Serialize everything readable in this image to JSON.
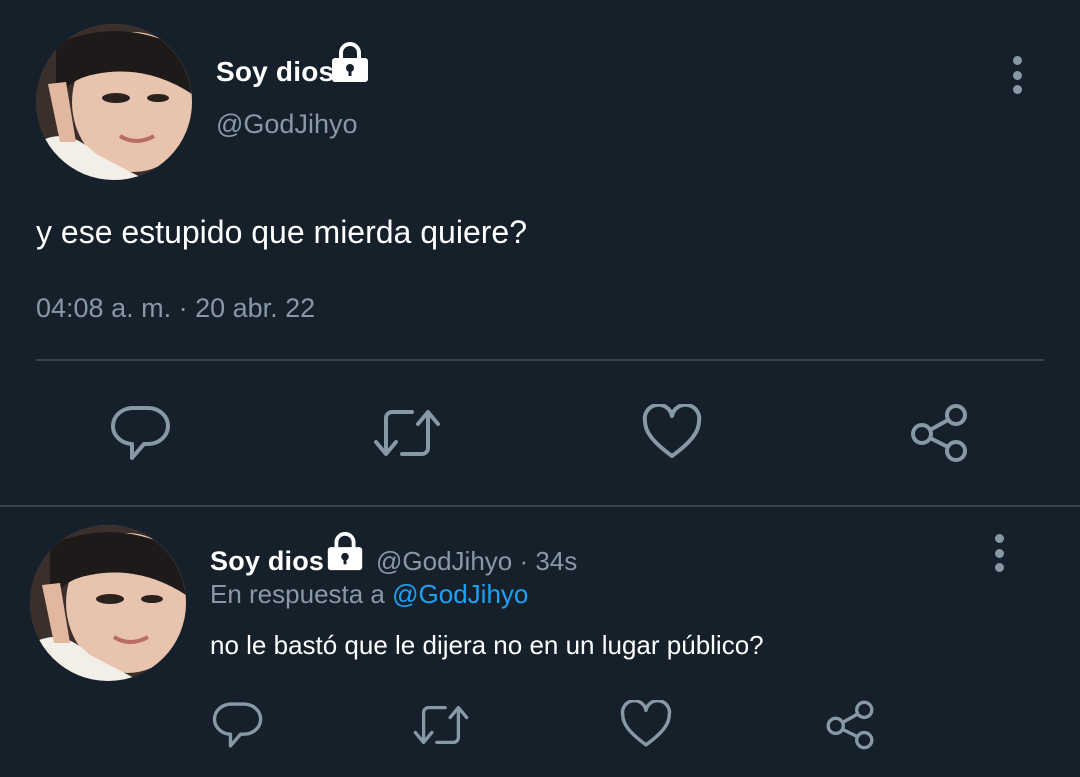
{
  "main_tweet": {
    "display_name": "Soy dios",
    "handle": "@GodJihyo",
    "text": "y ese estupido que mierda quiere?",
    "timestamp": "04:08 a. m. · 20 abr. 22"
  },
  "reply_tweet": {
    "display_name": "Soy dios",
    "handle_time": "@GodJihyo · 34s",
    "reply_prefix": "En respuesta a",
    "reply_to": "@GodJihyo",
    "text": "no le bastó que le dijera no en un lugar público?"
  },
  "icons": {
    "lock": "lock-icon",
    "more": "more-vertical-icon",
    "reply": "reply-icon",
    "retweet": "retweet-icon",
    "like": "heart-icon",
    "share": "share-icon"
  },
  "colors": {
    "background": "#15202b",
    "text": "#ffffff",
    "muted": "#8899a6",
    "link": "#1da1f2",
    "divider": "#38444d"
  }
}
